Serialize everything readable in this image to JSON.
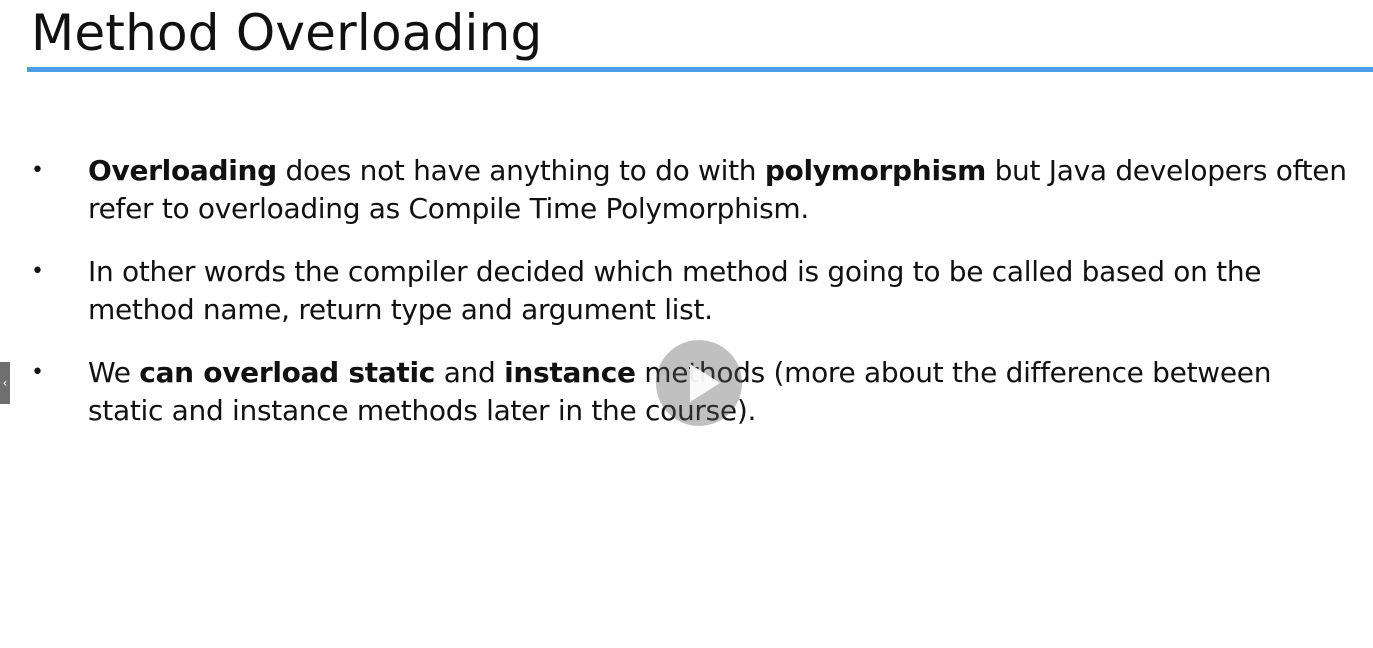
{
  "slide": {
    "title": "Method Overloading",
    "bullet_glyph": "•",
    "bullets": [
      {
        "b1": "Overloading",
        "t1": " does not have anything to do with ",
        "b2": "polymorphism",
        "t2": " but Java developers often refer to overloading as Compile Time Polymorphism."
      },
      {
        "t1": "In other words the compiler decided which method is going to be called based on the method name, return type and argument list."
      },
      {
        "t1": "We ",
        "b1": "can overload static",
        "t2": " and ",
        "b2": "instance",
        "t3": " methods (more about the difference between static and instance methods later in the course)."
      }
    ]
  },
  "player": {
    "play_icon": "play-icon",
    "side_tab_icon": "chevron-left-icon",
    "side_tab_glyph": "‹"
  },
  "colors": {
    "title_rule": "#4a9ee8",
    "text": "#111111",
    "play_overlay": "#5a5a5a"
  }
}
